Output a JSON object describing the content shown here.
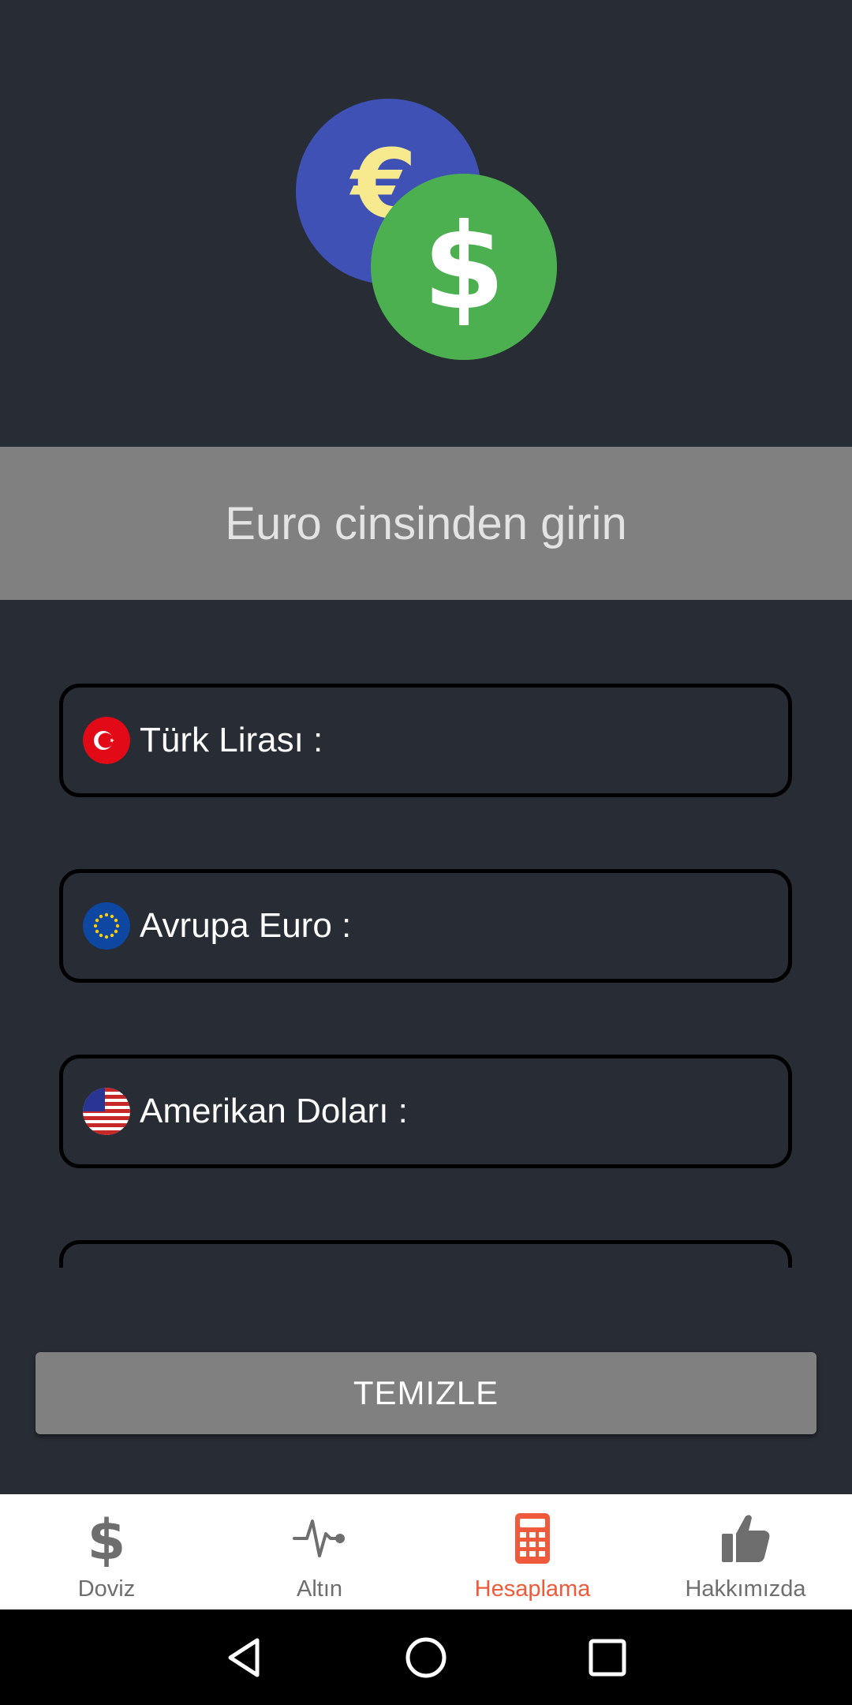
{
  "prompt": {
    "text": "Euro cinsinden girin"
  },
  "fields": [
    {
      "label": "Türk Lirası :",
      "flag": "turkey-flag-icon",
      "value": ""
    },
    {
      "label": "Avrupa Euro :",
      "flag": "eu-flag-icon",
      "value": ""
    },
    {
      "label": "Amerikan Doları :",
      "flag": "us-flag-icon",
      "value": ""
    }
  ],
  "clear_button": {
    "label": "TEMIZLE"
  },
  "bottom_nav": {
    "items": [
      {
        "label": "Doviz",
        "icon": "dollar-icon",
        "active": false
      },
      {
        "label": "Altın",
        "icon": "pulse-icon",
        "active": false
      },
      {
        "label": "Hesaplama",
        "icon": "calculator-icon",
        "active": true
      },
      {
        "label": "Hakkımızda",
        "icon": "thumbs-up-icon",
        "active": false
      }
    ]
  },
  "colors": {
    "background": "#282c34",
    "band": "#808080",
    "active": "#f05a3c",
    "inactive": "#6e6e6e",
    "euro_coin": "#3f51b5",
    "dollar_coin": "#4caf50"
  }
}
